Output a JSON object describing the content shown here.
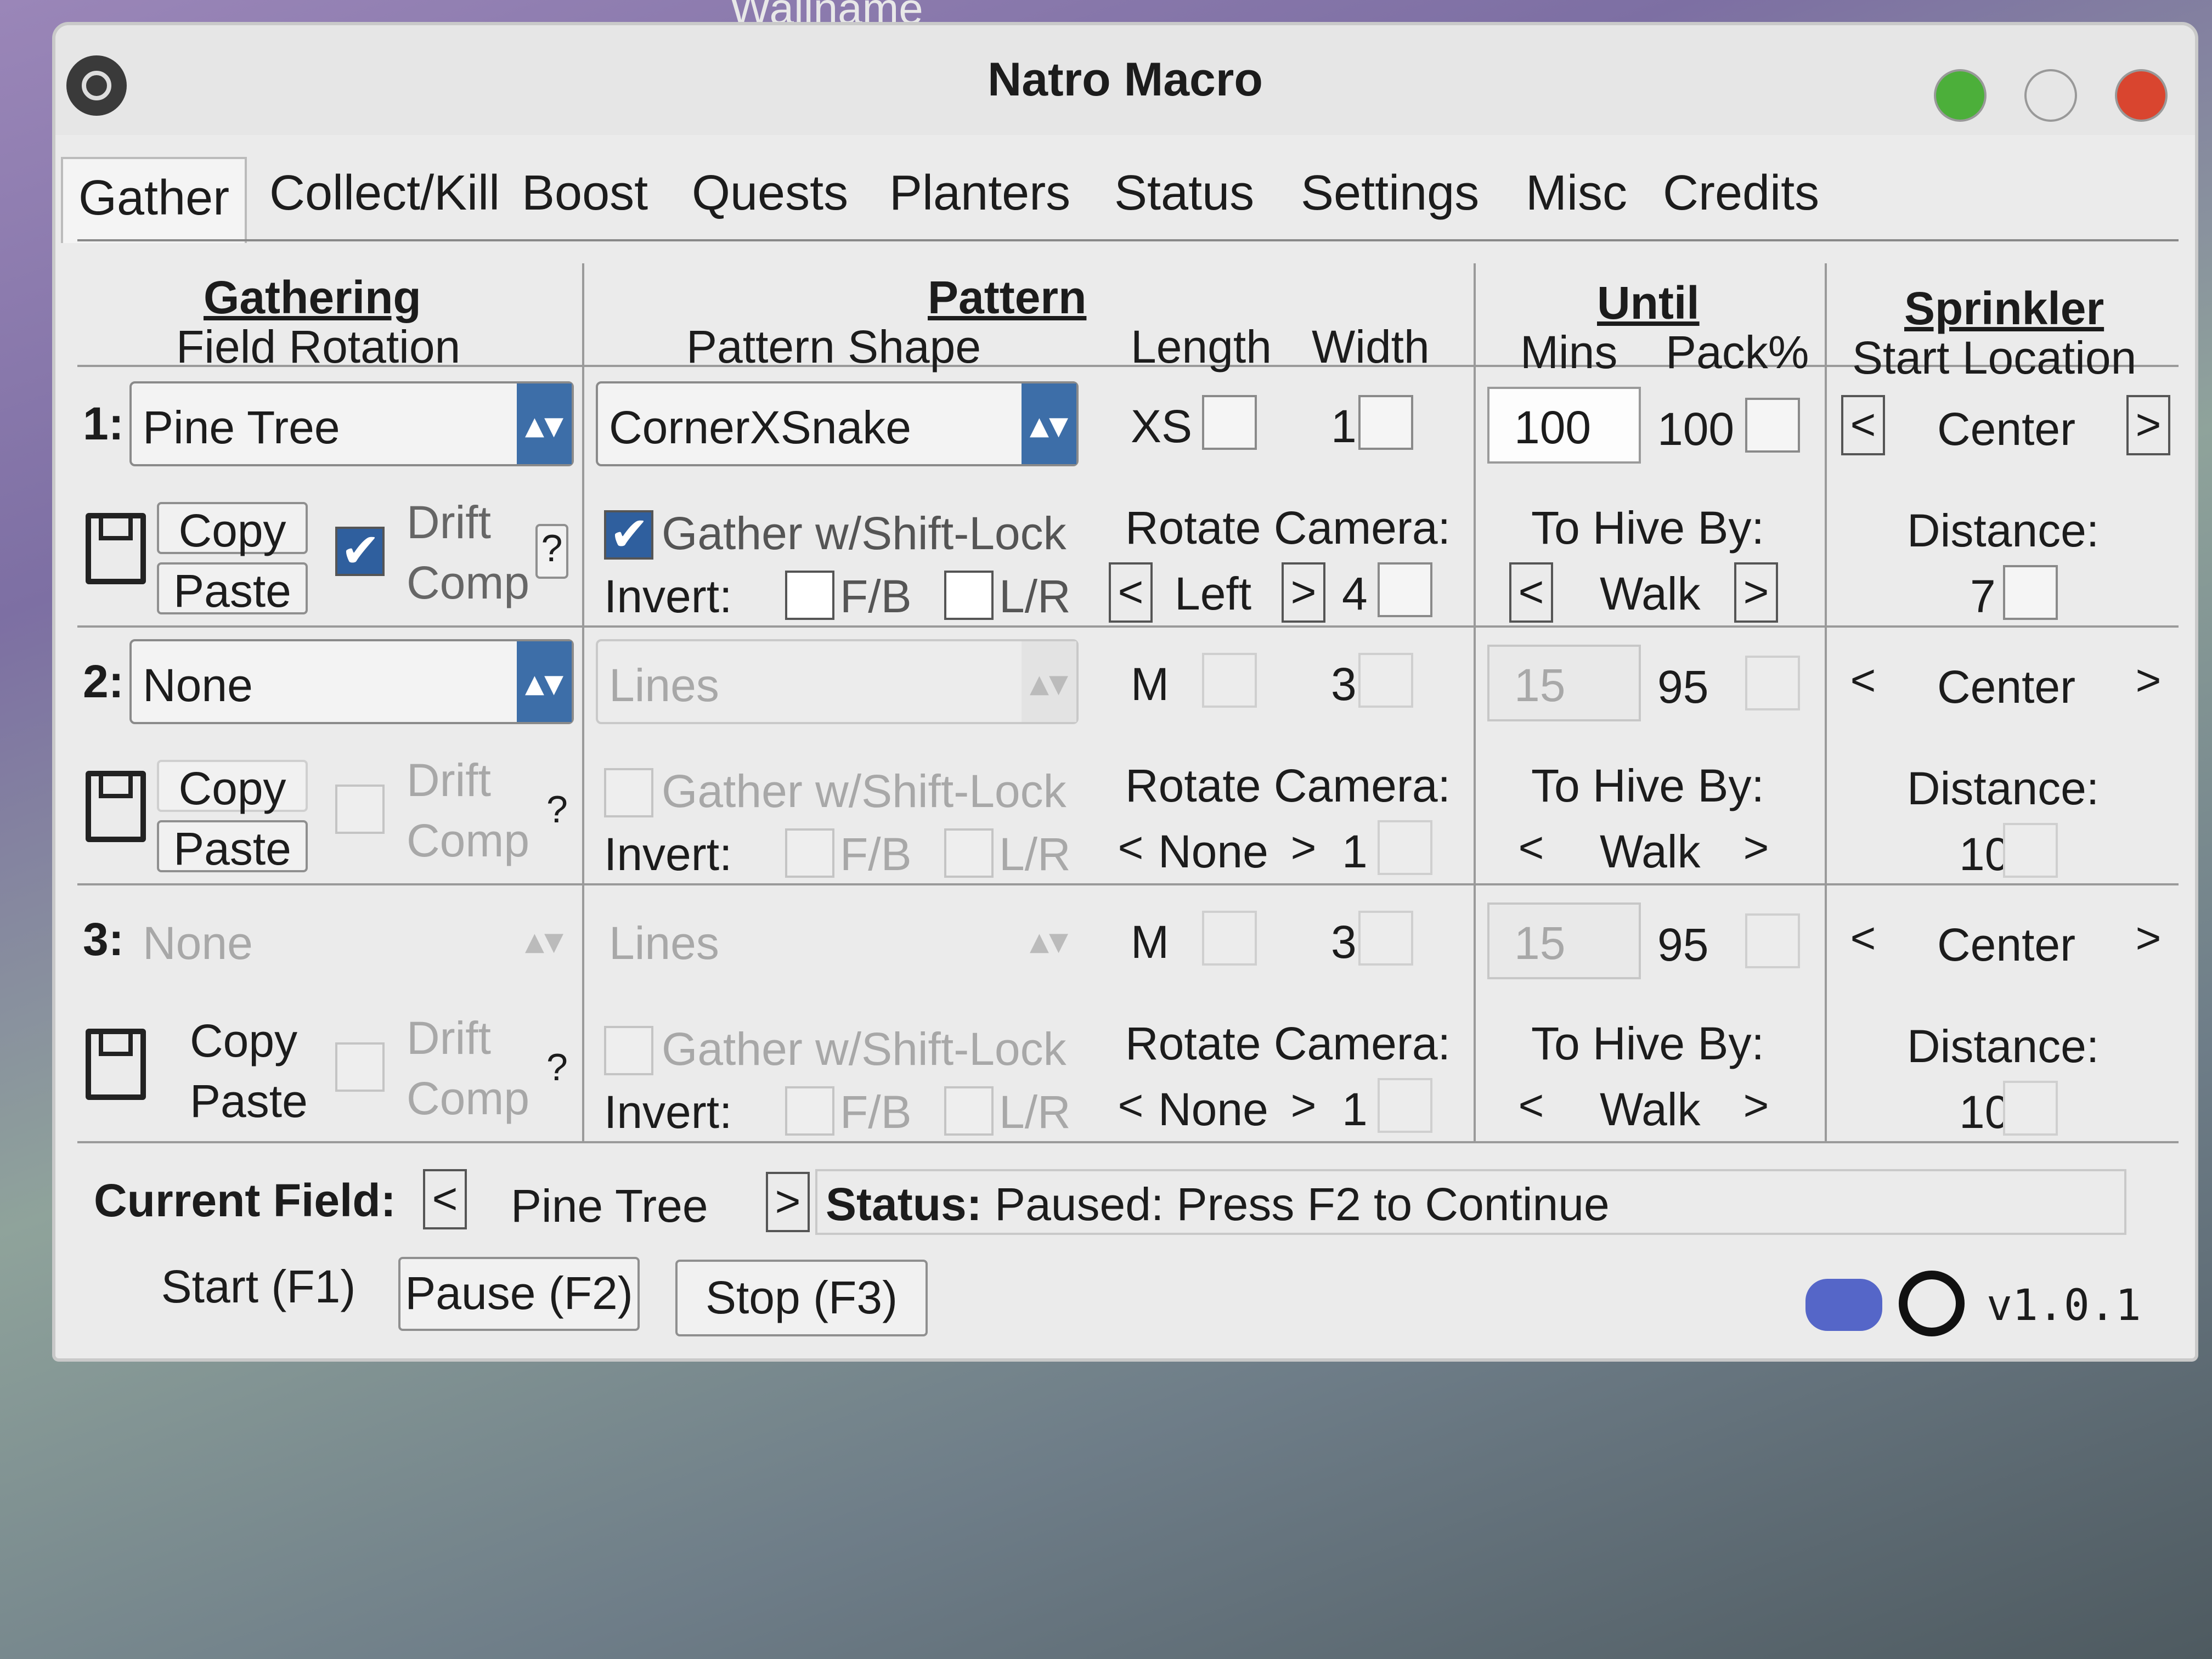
{
  "wallpaper_label": "Wallname",
  "window": {
    "title": "Natro Macro"
  },
  "tabs": [
    "Gather",
    "Collect/Kill",
    "Boost",
    "Quests",
    "Planters",
    "Status",
    "Settings",
    "Misc",
    "Credits"
  ],
  "headers": {
    "gathering": "Gathering",
    "field_rotation": "Field Rotation",
    "pattern": "Pattern",
    "pattern_shape": "Pattern Shape",
    "length": "Length",
    "width": "Width",
    "until": "Until",
    "mins": "Mins",
    "pack": "Pack%",
    "sprinkler": "Sprinkler",
    "start_location": "Start Location"
  },
  "labels": {
    "copy": "Copy",
    "paste": "Paste",
    "drift": "Drift",
    "comp": "Comp",
    "help": "?",
    "gather_shift": "Gather w/Shift-Lock",
    "invert": "Invert:",
    "fb": "F/B",
    "lr": "L/R",
    "rotate_camera": "Rotate Camera:",
    "to_hive_by": "To Hive By:",
    "distance": "Distance:",
    "left_arrow": "<",
    "right_arrow": ">"
  },
  "rows": [
    {
      "num": "1:",
      "field": "Pine Tree",
      "pattern": "CornerXSnake",
      "length": "XS",
      "width": "1",
      "mins": "100",
      "pack": "100",
      "start": "Center",
      "distance": "7",
      "rotate_dir": "Left",
      "rotate_count": "4",
      "hive_by": "Walk",
      "drift_comp": true,
      "shift_lock": true
    },
    {
      "num": "2:",
      "field": "None",
      "pattern": "Lines",
      "length": "M",
      "width": "3",
      "mins": "15",
      "pack": "95",
      "start": "Center",
      "distance": "10",
      "rotate_dir": "None",
      "rotate_count": "1",
      "hive_by": "Walk",
      "drift_comp": true,
      "shift_lock": false
    },
    {
      "num": "3:",
      "field": "None",
      "pattern": "Lines",
      "length": "M",
      "width": "3",
      "mins": "15",
      "pack": "95",
      "start": "Center",
      "distance": "10",
      "rotate_dir": "None",
      "rotate_count": "1",
      "hive_by": "Walk",
      "drift_comp": true,
      "shift_lock": false
    }
  ],
  "status": {
    "current_field_label": "Current Field:",
    "current_field": "Pine Tree",
    "status_label": "Status:",
    "status_text": "Paused: Press F2 to Continue"
  },
  "buttons": {
    "start": "Start (F1)",
    "pause": "Pause (F2)",
    "stop": "Stop (F3)"
  },
  "version": "v1.0.1",
  "colors": {
    "close": "#d9452f",
    "minimize": "#e6e6e6",
    "maximize": "#4caf3a",
    "accent": "#3d6ea8"
  }
}
